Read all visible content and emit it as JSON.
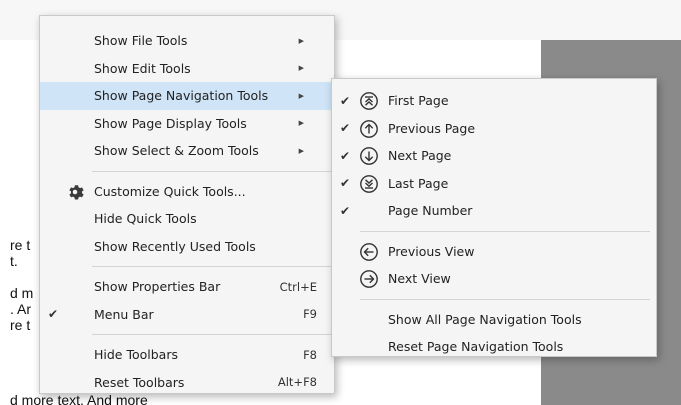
{
  "document": {
    "lines": [
      "re t",
      "t.",
      "d m",
      ". Ar",
      "re t",
      "d more text. And more"
    ]
  },
  "main_menu": {
    "show_file_tools": "Show File Tools",
    "show_edit_tools": "Show Edit Tools",
    "show_page_navigation_tools": "Show Page Navigation Tools",
    "show_page_display_tools": "Show Page Display Tools",
    "show_select_zoom_tools": "Show Select & Zoom Tools",
    "customize_quick_tools": "Customize Quick Tools...",
    "hide_quick_tools": "Hide Quick Tools",
    "show_recently_used_tools": "Show Recently Used Tools",
    "show_properties_bar": "Show Properties Bar",
    "show_properties_bar_shortcut": "Ctrl+E",
    "menu_bar": "Menu Bar",
    "menu_bar_shortcut": "F9",
    "hide_toolbars": "Hide Toolbars",
    "hide_toolbars_shortcut": "F8",
    "reset_toolbars": "Reset Toolbars",
    "reset_toolbars_shortcut": "Alt+F8",
    "checkmark": "✔",
    "submenu_arrow": "▶"
  },
  "sub_menu": {
    "first_page": "First Page",
    "previous_page": "Previous Page",
    "next_page": "Next Page",
    "last_page": "Last Page",
    "page_number": "Page Number",
    "previous_view": "Previous View",
    "next_view": "Next View",
    "show_all": "Show All Page Navigation Tools",
    "reset": "Reset Page Navigation Tools",
    "checkmark": "✔"
  },
  "colors": {
    "highlight": "#cfe4f7",
    "menu_bg": "#f5f5f5",
    "gray_area": "#8a8a8a"
  }
}
